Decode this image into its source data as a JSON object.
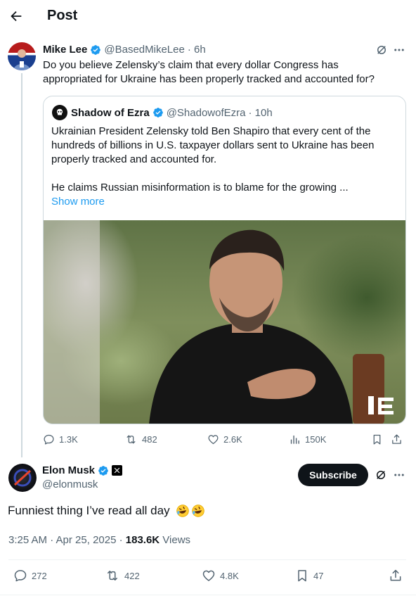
{
  "header": {
    "title": "Post",
    "back_icon": "arrow-left-icon"
  },
  "parent_tweet": {
    "name": "Mike Lee",
    "handle": "@BasedMikeLee",
    "time": "· 6h",
    "text": "Do you believe Zelensky’s claim that every dollar Congress has appropriated for Ukraine has been properly tracked and accounted for?",
    "quote": {
      "name": "Shadow of Ezra",
      "handle": "@ShadowofEzra",
      "time": "· 10h",
      "text_1": "Ukrainian President Zelensky told Ben Shapiro that every cent of the hundreds of billions in U.S. taxpayer dollars sent to Ukraine has been properly tracked and accounted for.",
      "text_2": "He claims Russian misinformation is to blame for the growing ...",
      "show_more": "Show more"
    },
    "stats": {
      "replies": "1.3K",
      "reposts": "482",
      "likes": "2.6K",
      "views": "150K"
    }
  },
  "main_tweet": {
    "name": "Elon Musk",
    "handle": "@elonmusk",
    "subscribe_label": "Subscribe",
    "text": "Funniest thing I’ve read all day",
    "emoji": [
      "rolling-on-floor-laughing",
      "rolling-on-floor-laughing"
    ],
    "timestamp": "3:25 AM · Apr 25, 2025 · ",
    "views_count": "183.6K",
    "views_label": " Views",
    "stats": {
      "replies": "272",
      "reposts": "422",
      "likes": "4.8K",
      "bookmarks": "47"
    }
  },
  "colors": {
    "accent": "#1d9bf0",
    "verified": "#1d9bf0",
    "text": "#0f1419",
    "muted": "#536471",
    "border": "#cfd9de"
  }
}
